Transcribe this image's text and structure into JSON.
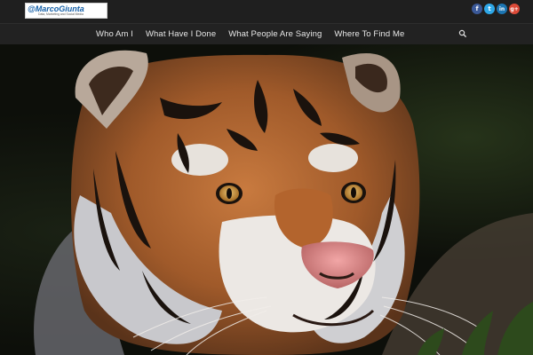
{
  "header": {
    "logo": {
      "brand": "@MarcoGiunta",
      "tagline": "Data, Marketing and Social Media"
    },
    "social_icons": [
      {
        "icon": "facebook-icon",
        "glyph": "f",
        "color": "#3b5998"
      },
      {
        "icon": "twitter-icon",
        "glyph": "t",
        "color": "#2fa8e8"
      },
      {
        "icon": "linkedin-icon",
        "glyph": "in",
        "color": "#1c75b2"
      },
      {
        "icon": "google-plus-icon",
        "glyph": "g+",
        "color": "#dc4a38"
      }
    ]
  },
  "nav": {
    "items": [
      {
        "label": "Who Am I"
      },
      {
        "label": "What Have I Done"
      },
      {
        "label": "What People Are Saying"
      },
      {
        "label": "Where To Find Me"
      }
    ],
    "search_icon": "search-icon"
  },
  "hero": {
    "image": "tiger-photo"
  }
}
